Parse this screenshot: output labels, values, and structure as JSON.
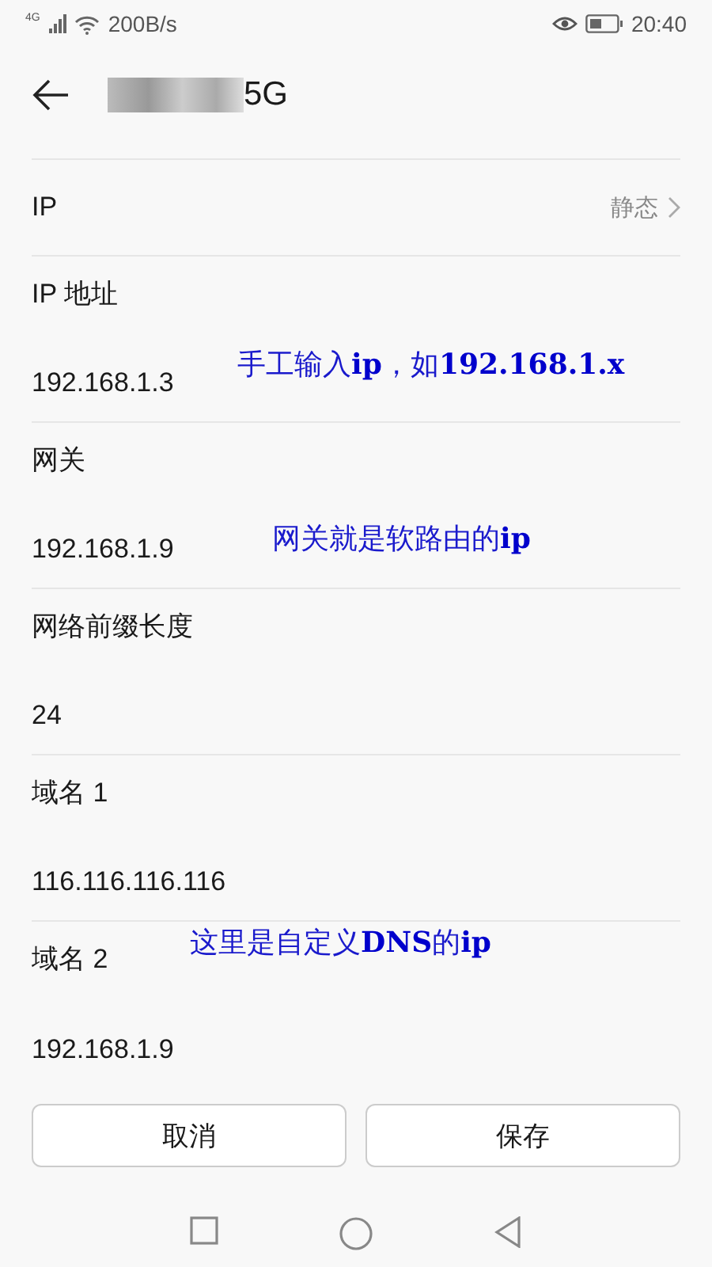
{
  "status_bar": {
    "network": "4G",
    "speed": "200B/s",
    "time": "20:40"
  },
  "header": {
    "title": "5G"
  },
  "fields": [
    {
      "kind": "select",
      "label": "IP",
      "value": "静态"
    },
    {
      "kind": "input",
      "label": "IP 地址",
      "value": "192.168.1.3"
    },
    {
      "kind": "input",
      "label": "网关",
      "value": "192.168.1.9"
    },
    {
      "kind": "input",
      "label": "网络前缀长度",
      "value": "24"
    },
    {
      "kind": "input",
      "label": "域名 1",
      "value": "116.116.116.116"
    },
    {
      "kind": "input",
      "label": "域名 2",
      "value": "192.168.1.9"
    }
  ],
  "annotations": [
    "手工输入**ip**，如**192.168.1.x**",
    "网关就是软路由的**ip**",
    "这里是自定义**DNS**的**ip**"
  ],
  "buttons": [
    "取消",
    "保存"
  ]
}
